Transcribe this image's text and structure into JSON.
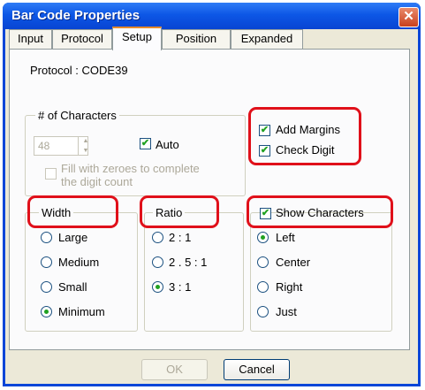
{
  "window": {
    "title": "Bar Code Properties",
    "close_symbol": "✕"
  },
  "tabs": [
    {
      "label": "Input",
      "active": false
    },
    {
      "label": "Protocol",
      "active": false
    },
    {
      "label": "Setup",
      "active": true
    },
    {
      "label": "Position",
      "active": false
    },
    {
      "label": "Expanded",
      "active": false
    }
  ],
  "setup": {
    "protocol_label": "Protocol : CODE39",
    "characters": {
      "legend": "# of Characters",
      "count_value": "48",
      "auto_label": "Auto",
      "auto_checked": true,
      "fill_zeroes_label_line1": "Fill with zeroes to complete",
      "fill_zeroes_label_line2": "the digit count",
      "fill_zeroes_checked": false
    },
    "options": {
      "add_margins_label": "Add Margins",
      "add_margins_checked": true,
      "check_digit_label": "Check Digit",
      "check_digit_checked": true
    },
    "width": {
      "legend": "Width",
      "options": [
        "Large",
        "Medium",
        "Small",
        "Minimum"
      ],
      "selected": "Minimum"
    },
    "ratio": {
      "legend": "Ratio",
      "options": [
        "2 : 1",
        "2 . 5 : 1",
        "3 : 1"
      ],
      "selected": "3 : 1"
    },
    "show_characters": {
      "legend": "Show Characters",
      "checked": true,
      "options": [
        "Left",
        "Center",
        "Right",
        "Just"
      ],
      "selected": "Left"
    }
  },
  "buttons": {
    "ok_label": "OK",
    "cancel_label": "Cancel"
  },
  "colors": {
    "highlight": "#e0101a",
    "titlebar": "#0d57e6",
    "check_mark": "#21a121"
  }
}
